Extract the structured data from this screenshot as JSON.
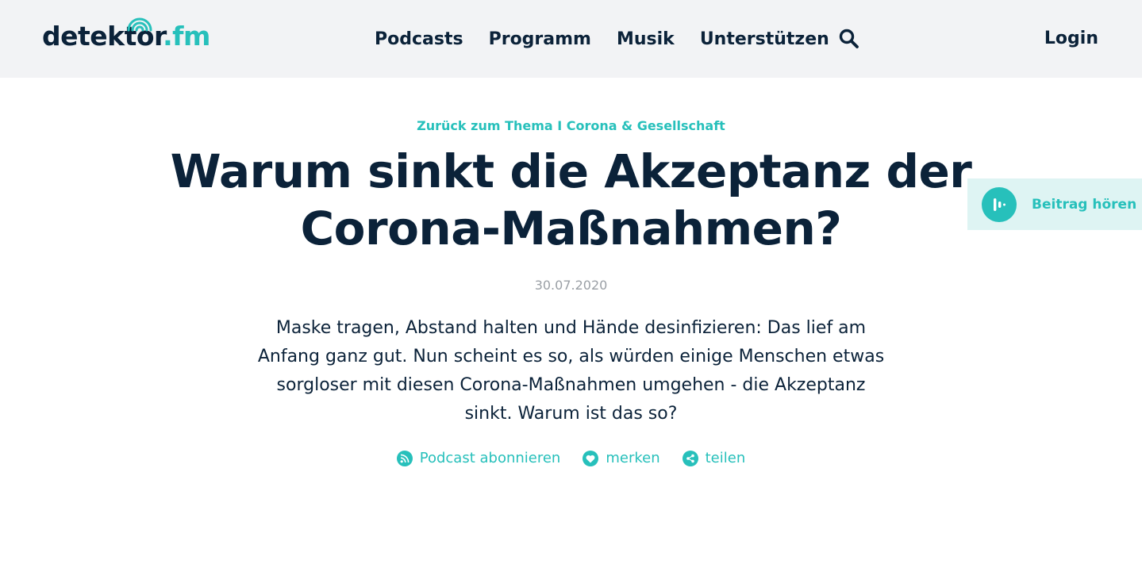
{
  "header": {
    "logo": {
      "main": "detektor",
      "tld": ".fm"
    },
    "nav": [
      {
        "label": "Podcasts"
      },
      {
        "label": "Programm"
      },
      {
        "label": "Musik"
      },
      {
        "label": "Unterstützen"
      }
    ],
    "search_icon": "search-icon",
    "login_label": "Login"
  },
  "article": {
    "breadcrumb": "Zurück zum Thema I Corona & Gesellschaft",
    "title": "Warum sinkt die Akzeptanz der Corona-Maßnahmen?",
    "date": "30.07.2020",
    "teaser": "Maske tragen, Abstand halten und Hände desinfizieren: Das lief am Anfang ganz gut. Nun scheint es so, als würden einige Menschen etwas sorgloser mit diesen Corona-Maßnahmen umgehen - die Akzeptanz sinkt. Warum ist das so?"
  },
  "actions": [
    {
      "label": "Podcast abonnieren",
      "icon": "rss-icon"
    },
    {
      "label": "merken",
      "icon": "heart-icon"
    },
    {
      "label": "teilen",
      "icon": "share-icon"
    }
  ],
  "listen": {
    "label": "Beitrag hören",
    "icon": "audio-bars-icon"
  },
  "colors": {
    "accent": "#27c0bb",
    "text": "#0b2239",
    "header_bg": "#f2f3f5",
    "listen_bg": "#def4f3",
    "date": "#9a9fa5"
  }
}
